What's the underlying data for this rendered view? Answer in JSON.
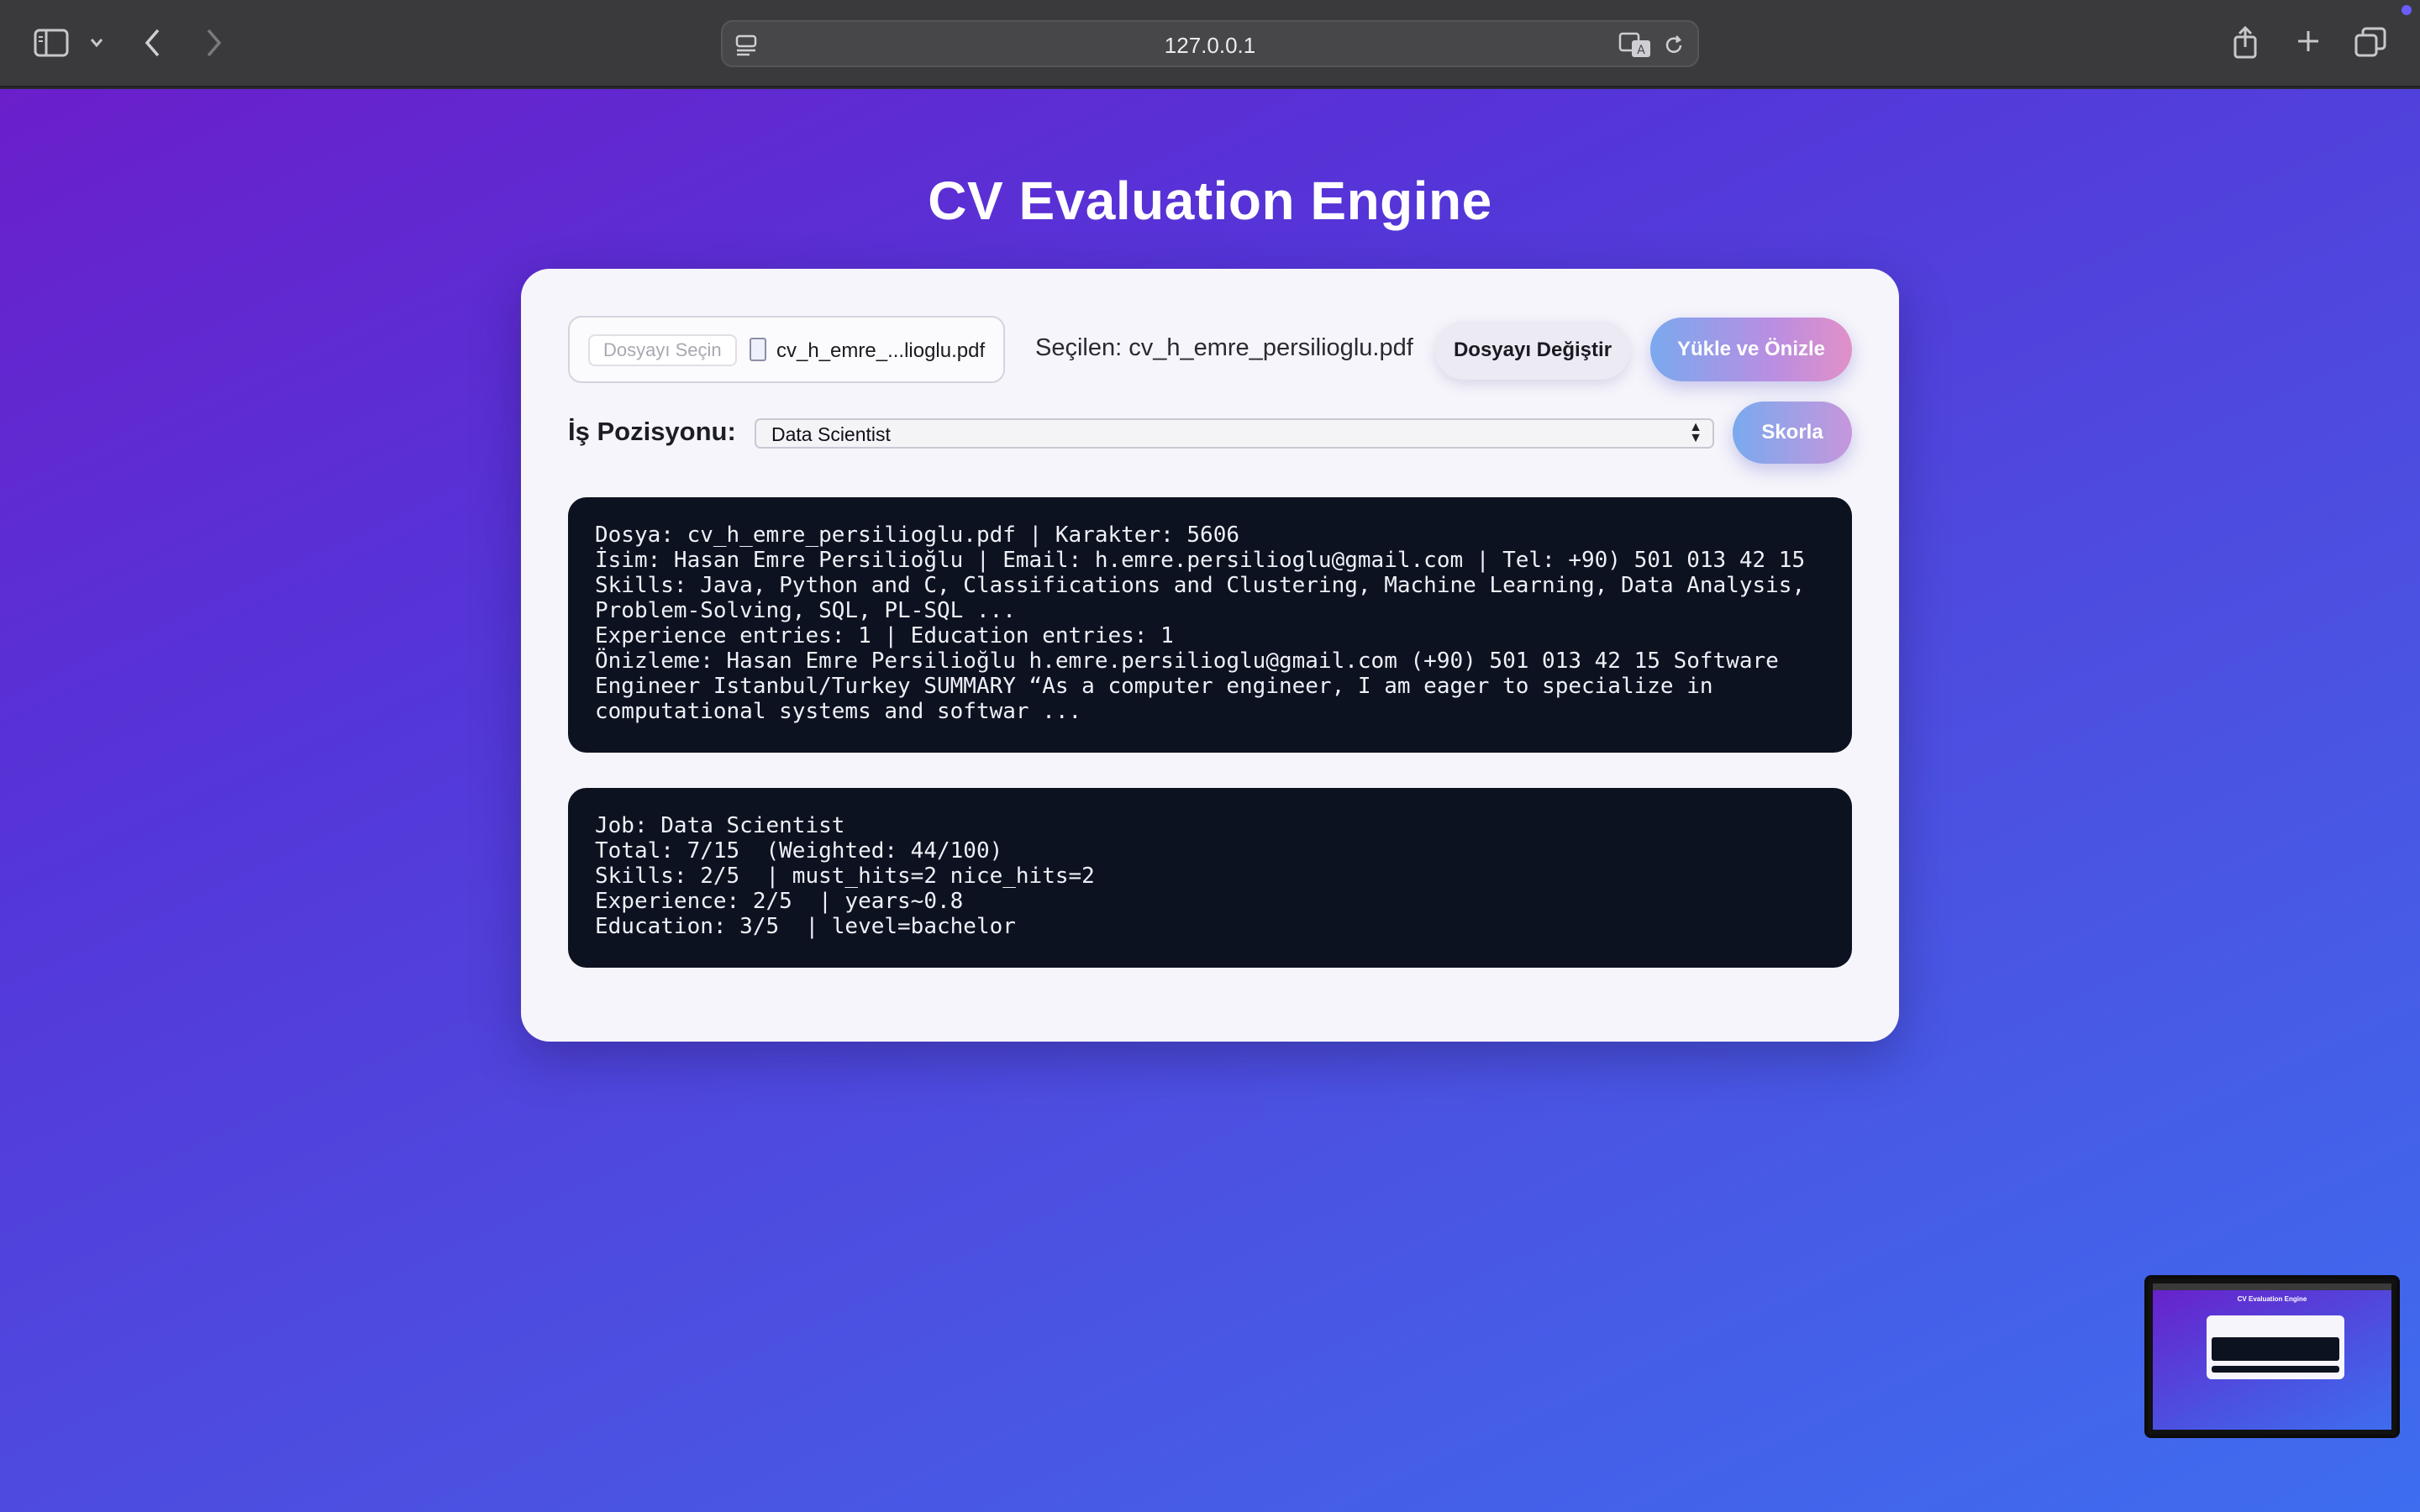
{
  "browser": {
    "url": "127.0.0.1"
  },
  "page": {
    "title": "CV Evaluation Engine"
  },
  "upload": {
    "choose_file_label": "Dosyayı Seçin",
    "file_name": "cv_h_emre_...lioglu.pdf",
    "selected_text": "Seçilen: cv_h_emre_persilioglu.pdf",
    "change_button": "Dosyayı Değiştir",
    "upload_button": "Yükle ve Önizle"
  },
  "job": {
    "label": "İş Pozisyonu:",
    "selected": "Data Scientist",
    "score_button": "Skorla"
  },
  "preview_output": "Dosya: cv_h_emre_persilioglu.pdf | Karakter: 5606\nİsim: Hasan Emre Persilioğlu | Email: h.emre.persilioglu@gmail.com | Tel: +90) 501 013 42 15\nSkills: Java, Python and C, Classifications and Clustering, Machine Learning, Data Analysis,\nProblem-Solving, SQL, PL-SQL ...\nExperience entries: 1 | Education entries: 1\nÖnizleme: Hasan Emre Persilioğlu h.emre.persilioglu@gmail.com (+90) 501 013 42 15 Software\nEngineer Istanbul/Turkey SUMMARY “As a computer engineer, I am eager to specialize in\ncomputational systems and softwar ...",
  "score_output": "Job: Data Scientist\nTotal: 7/15  (Weighted: 44/100)\nSkills: 2/5  | must_hits=2 nice_hits=2\nExperience: 2/5  | years~0.8\nEducation: 3/5  | level=bachelor",
  "thumbnail": {
    "title": "CV Evaluation Engine"
  },
  "colors": {
    "gradient_start": "#6a1fcb",
    "gradient_end": "#3e6df0",
    "terminal_bg": "#0d1221",
    "card_bg": "#f6f5fb"
  }
}
